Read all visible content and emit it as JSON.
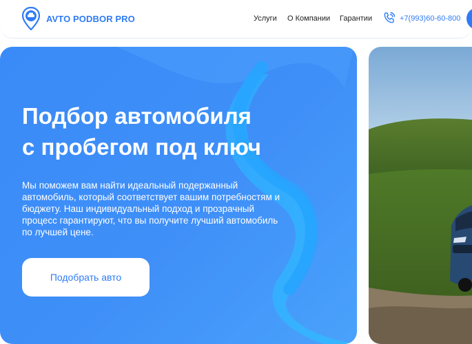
{
  "brand": {
    "name": "AVTO PODBOR PRO",
    "logo_icon": "car-pin-icon"
  },
  "nav": {
    "items": [
      "Услуги",
      "О Компании",
      "Гарантии"
    ]
  },
  "contact": {
    "phone": "+7(993)60-60-800",
    "phone_icon": "phone-ringing-icon"
  },
  "hero": {
    "title_line1": "Подбор автомобиля",
    "title_line2": "с пробегом под ключ",
    "description": "Мы поможем вам найти идеальный подержанный автомобиль, который соответствует вашим потребностям и бюджету. Наш индивидуальный подход и прозрачный процесс гарантируют, что вы получите лучший автомобиль по лучшей цене.",
    "cta_label": "Подобрать авто"
  },
  "colors": {
    "accent": "#2f7bf6",
    "hero_bg": "#3f8ff8",
    "header_border": "#e3e9f2"
  }
}
